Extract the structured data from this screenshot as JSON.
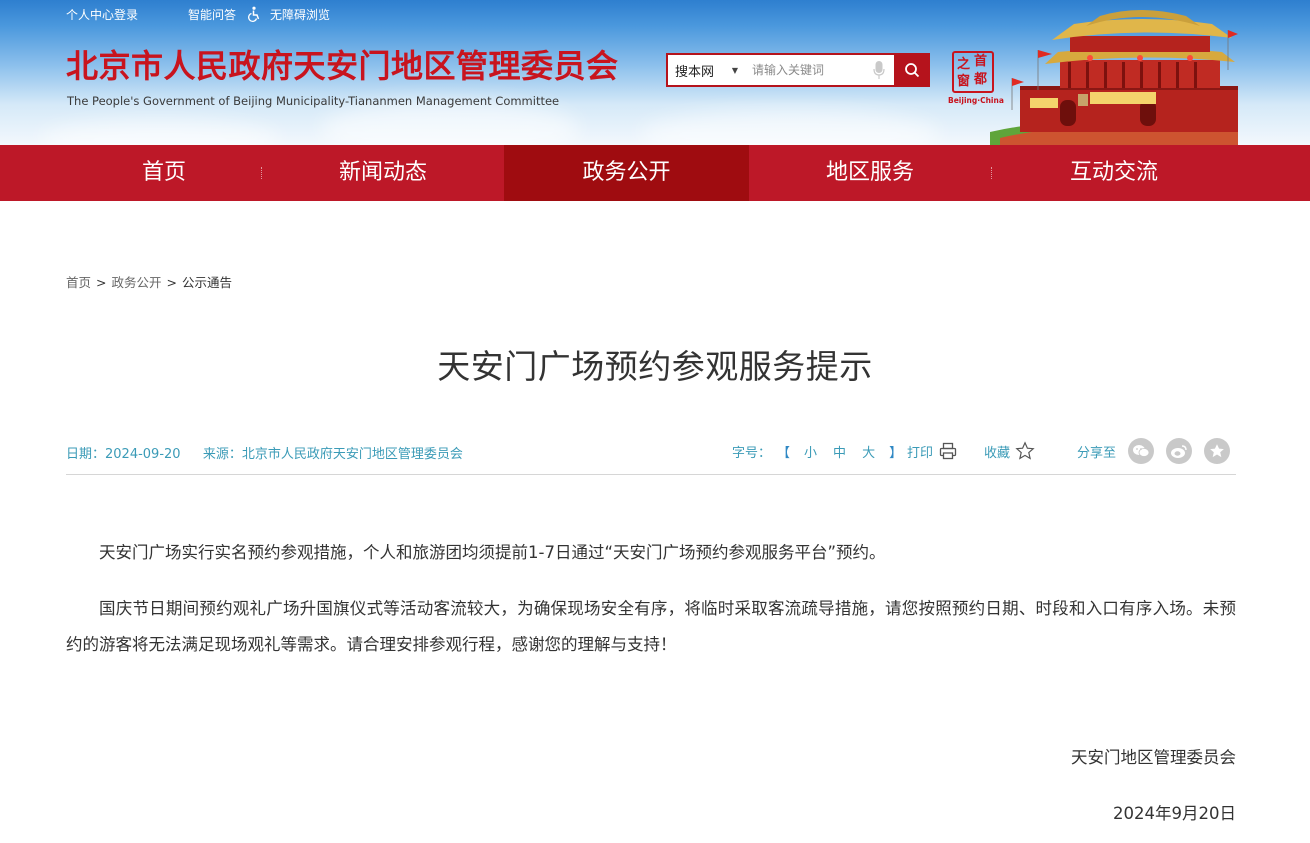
{
  "topbar": {
    "login": "个人中心登录",
    "qa": "智能问答",
    "accessible": "无障碍浏览"
  },
  "header": {
    "title": "北京市人民政府天安门地区管理委员会",
    "subtitle": "The People's Government of Beijing Municipality-Tiananmen Management Committee",
    "seal_chars": [
      "首",
      "都",
      "之",
      "窗"
    ],
    "seal_caption": "Beijing·China"
  },
  "search": {
    "scope": "搜本网",
    "placeholder": "请输入关键词"
  },
  "nav": {
    "items": [
      "首页",
      "新闻动态",
      "政务公开",
      "地区服务",
      "互动交流"
    ],
    "active": "政务公开"
  },
  "breadcrumb": {
    "items": [
      "首页",
      "政务公开",
      "公示通告"
    ],
    "sep": ">"
  },
  "article": {
    "title": "天安门广场预约参观服务提示",
    "date_label": "日期：",
    "date": "2024-09-20",
    "source_label": "来源：",
    "source": "北京市人民政府天安门地区管理委员会",
    "paragraphs": [
      "天安门广场实行实名预约参观措施，个人和旅游团均须提前1-7日通过“天安门广场预约参观服务平台”预约。",
      "国庆节日期间预约观礼广场升国旗仪式等活动客流较大，为确保现场安全有序，将临时采取客流疏导措施，请您按照预约日期、时段和入口有序入场。未预约的游客将无法满足现场观礼等需求。请合理安排参观行程，感谢您的理解与支持！"
    ],
    "signature": "天安门地区管理委员会",
    "sign_date": "2024年9月20日"
  },
  "tools": {
    "font_label": "字号：",
    "bracket_open": "【",
    "bracket_close": "】",
    "sizes": [
      "小",
      "中",
      "大"
    ],
    "print": "打印",
    "favorite": "收藏",
    "share": "分享至"
  },
  "colors": {
    "brand_red": "#bd1828",
    "nav_active": "#9f0c10",
    "meta_blue": "#3b9bb7"
  }
}
